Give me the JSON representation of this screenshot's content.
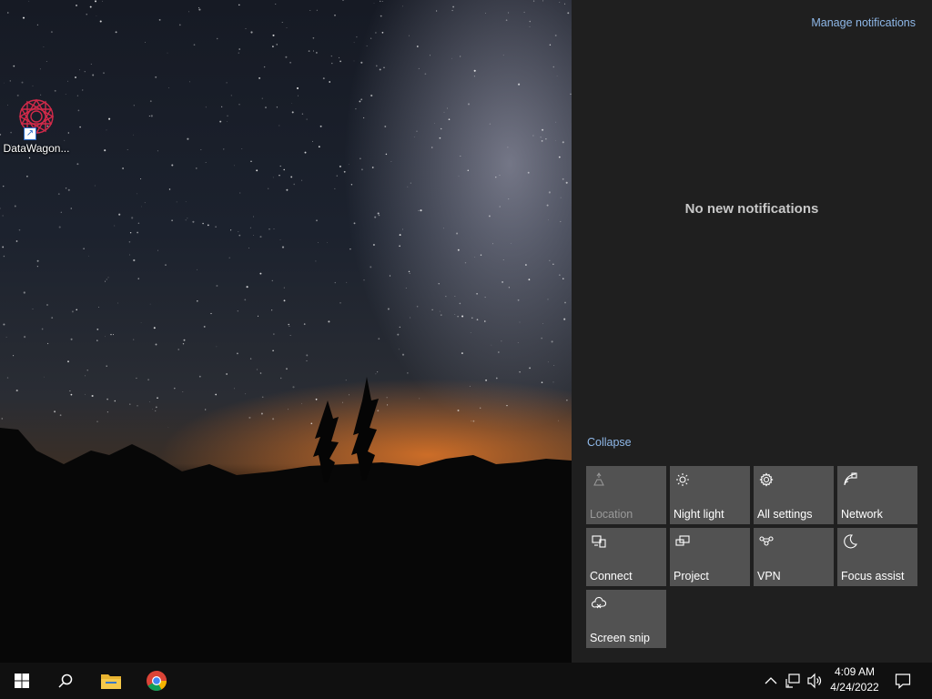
{
  "desktop": {
    "icons": [
      {
        "label": "DataWagon..."
      }
    ]
  },
  "action_center": {
    "manage_label": "Manage notifications",
    "empty_message": "No new notifications",
    "collapse_label": "Collapse",
    "tiles": [
      {
        "label": "Location",
        "icon": "location-icon",
        "enabled": false
      },
      {
        "label": "Night light",
        "icon": "night-light-icon",
        "enabled": true
      },
      {
        "label": "All settings",
        "icon": "gear-icon",
        "enabled": true
      },
      {
        "label": "Network",
        "icon": "network-icon",
        "enabled": true
      },
      {
        "label": "Connect",
        "icon": "connect-icon",
        "enabled": true
      },
      {
        "label": "Project",
        "icon": "project-icon",
        "enabled": true
      },
      {
        "label": "VPN",
        "icon": "vpn-icon",
        "enabled": true
      },
      {
        "label": "Focus assist",
        "icon": "moon-icon",
        "enabled": true
      },
      {
        "label": "Screen snip",
        "icon": "screen-snip-icon",
        "enabled": true
      }
    ]
  },
  "taskbar": {
    "apps": [
      "start-icon",
      "search-icon",
      "file-explorer-icon",
      "chrome-icon"
    ],
    "tray": [
      "chevron-up-icon",
      "network-icon",
      "volume-icon"
    ],
    "time": "4:09 AM",
    "date": "4/24/2022"
  },
  "colors": {
    "accent_link": "#8fb8e8",
    "panel_bg": "#1f1f1f",
    "tile_bg": "#525252",
    "taskbar_bg": "#101010"
  }
}
